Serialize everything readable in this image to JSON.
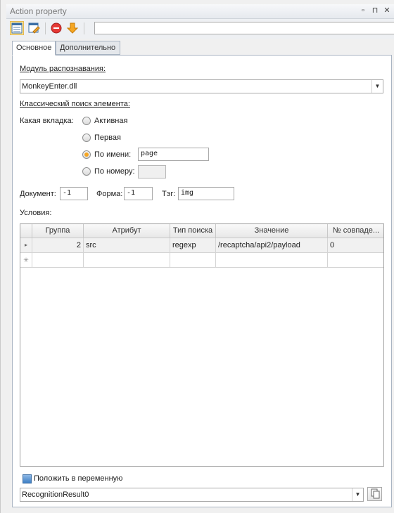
{
  "window": {
    "title": "Action property"
  },
  "title_buttons": {
    "restore": "▫",
    "pin": "⊓",
    "close": "✕"
  },
  "toolbar": {
    "icons": [
      "properties-icon",
      "edit-icon",
      "stop-icon",
      "down-arrow-icon"
    ],
    "input_value": ""
  },
  "tabs": [
    {
      "label": "Основное",
      "active": true
    },
    {
      "label": "Дополнительно",
      "active": false
    }
  ],
  "module": {
    "label": "Модуль распознавания:",
    "value": "MonkeyEnter.dll"
  },
  "classic_search": {
    "label": "Классический поиск элемента:"
  },
  "tab_choice": {
    "label": "Какая вкладка:",
    "options": [
      {
        "label": "Активная",
        "selected": false
      },
      {
        "label": "Первая",
        "selected": false
      },
      {
        "label": "По имени:",
        "selected": true
      },
      {
        "label": "По номеру:",
        "selected": false
      }
    ],
    "name_value": "page",
    "number_value": ""
  },
  "fields": {
    "document_label": "Документ:",
    "document_value": "-1",
    "form_label": "Форма:",
    "form_value": "-1",
    "tag_label": "Тэг:",
    "tag_value": "img"
  },
  "conditions": {
    "label": "Условия:",
    "columns": [
      "Группа",
      "Атрибут",
      "Тип поиска",
      "Значение",
      "№ совпаде..."
    ],
    "rows": [
      {
        "group": "2",
        "attribute": "src",
        "search_type": "regexp",
        "value": "/recaptcha/api2/payload",
        "match_no": "0"
      }
    ],
    "new_row_marker": "✳",
    "current_row_marker": "▸"
  },
  "put_in_variable": {
    "label": "Положить в переменную",
    "checked": true,
    "value": "RecognitionResult0"
  },
  "colors": {
    "accent": "#f5a623",
    "selection": "#fde79b"
  }
}
